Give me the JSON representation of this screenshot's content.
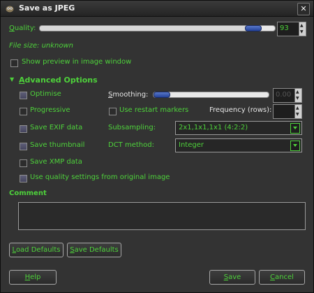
{
  "window": {
    "title": "Save as JPEG",
    "close_glyph": "✕"
  },
  "quality": {
    "label_accel": "Q",
    "label_rest": "uality:",
    "value": "93",
    "slider_fraction": 0.93
  },
  "file_size": "File size: unknown",
  "show_preview": {
    "label": "Show preview in image window",
    "checked": false
  },
  "advanced": {
    "label_accel": "A",
    "label_rest": "dvanced Options",
    "expanded": true
  },
  "options": {
    "optimise": {
      "label": "Optimise",
      "checked": true
    },
    "progressive": {
      "label": "Progressive",
      "checked": false
    },
    "save_exif": {
      "label": "Save EXIF data",
      "checked": true
    },
    "save_thumbnail": {
      "label": "Save thumbnail",
      "checked": true
    },
    "save_xmp": {
      "label": "Save XMP data",
      "checked": false
    },
    "use_quality": {
      "label": "Use quality settings from original image",
      "checked": true
    }
  },
  "smoothing": {
    "label_accel": "S",
    "label_rest": "moothing:",
    "value": "0.00",
    "slider_fraction": 0.0
  },
  "restart_markers": {
    "label": "Use restart markers",
    "checked": false
  },
  "frequency": {
    "label": "Frequency (rows):",
    "value": ""
  },
  "subsampling": {
    "label": "Subsampling:",
    "value": "2x1,1x1,1x1 (4:2:2)"
  },
  "dct": {
    "label": "DCT method:",
    "value": "Integer"
  },
  "comment": {
    "label": "Comment",
    "value": ""
  },
  "buttons": {
    "load_defaults": {
      "accel": "L",
      "rest": "oad Defaults"
    },
    "save_defaults": {
      "accel": "S",
      "rest": "ave Defaults"
    },
    "help": {
      "accel": "H",
      "rest": "elp"
    },
    "save": {
      "accel": "S",
      "rest": "ave"
    },
    "cancel": {
      "accel": "C",
      "rest": "ancel"
    }
  },
  "colors": {
    "accent": "#4ed23b",
    "background": "#333333",
    "slider_handle": "#2a4aa8"
  }
}
